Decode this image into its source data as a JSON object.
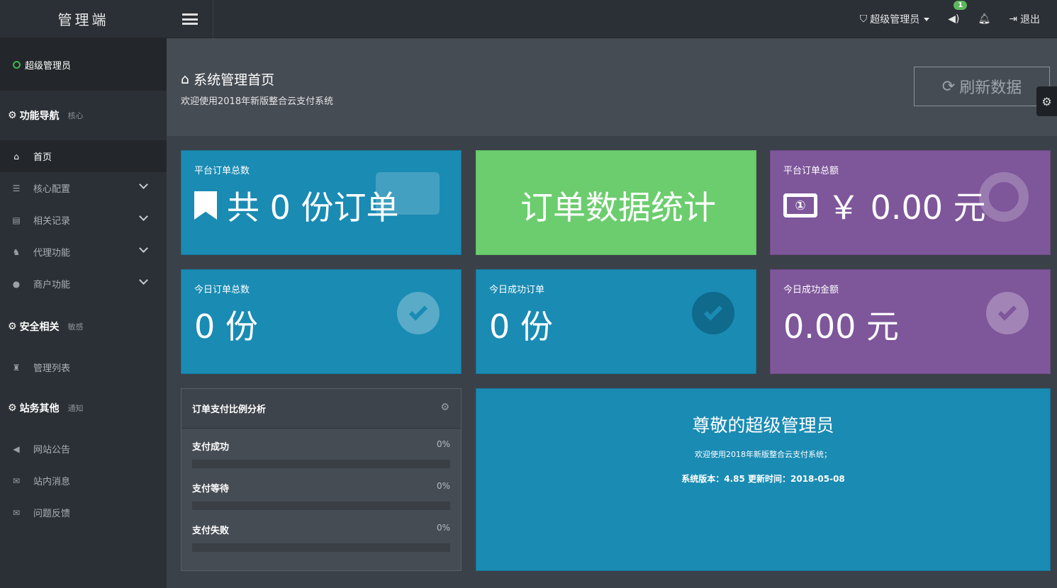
{
  "sidebar": {
    "brand": "管理端",
    "user": "超级管理员",
    "sections": [
      {
        "title": "功能导航",
        "sub": "核心"
      },
      {
        "title": "安全相关",
        "sub": "敏感"
      },
      {
        "title": "站务其他",
        "sub": "通知"
      }
    ],
    "items": [
      {
        "label": "首页",
        "icon": "home-icon"
      },
      {
        "label": "核心配置",
        "icon": "sliders-icon"
      },
      {
        "label": "相关记录",
        "icon": "list-icon"
      },
      {
        "label": "代理功能",
        "icon": "agent-icon"
      },
      {
        "label": "商户功能",
        "icon": "user-icon"
      },
      {
        "label": "管理列表",
        "icon": "admin-icon"
      },
      {
        "label": "网站公告",
        "icon": "volume-icon"
      },
      {
        "label": "站内消息",
        "icon": "envelope-icon"
      },
      {
        "label": "问题反馈",
        "icon": "envelope-icon"
      }
    ]
  },
  "topbar": {
    "admin_label": "超级管理员",
    "notify_count": "1",
    "logout_label": "退出"
  },
  "header": {
    "title": "系统管理首页",
    "subtitle": "欢迎使用2018年新版整合云支付系统",
    "refresh_label": "刷新数据"
  },
  "cards": {
    "orders_total_label": "平台订单总数",
    "orders_total_value": "共 0 份订单",
    "stats_title": "订单数据统计",
    "amount_total_label": "平台订单总额",
    "amount_total_value": "￥ 0.00 元",
    "today_orders_label": "今日订单总数",
    "today_orders_value": "0 份",
    "today_success_label": "今日成功订单",
    "today_success_value": "0 份",
    "today_amount_label": "今日成功金额",
    "today_amount_value": "0.00 元"
  },
  "analysis": {
    "title": "订单支付比例分析",
    "rows": [
      {
        "label": "支付成功",
        "pct": "0%",
        "value": 0
      },
      {
        "label": "支付等待",
        "pct": "0%",
        "value": 0
      },
      {
        "label": "支付失败",
        "pct": "0%",
        "value": 0
      }
    ]
  },
  "welcome": {
    "heading": "尊敬的超级管理员",
    "line1": "欢迎使用2018年新版整合云支付系统；",
    "line2": "系统版本：4.85 更新时间：2018-05-08"
  },
  "colors": {
    "blue": "#1a8bb3",
    "green": "#6ccd6e",
    "purple": "#7e569a",
    "sidebar": "#2b3036"
  }
}
